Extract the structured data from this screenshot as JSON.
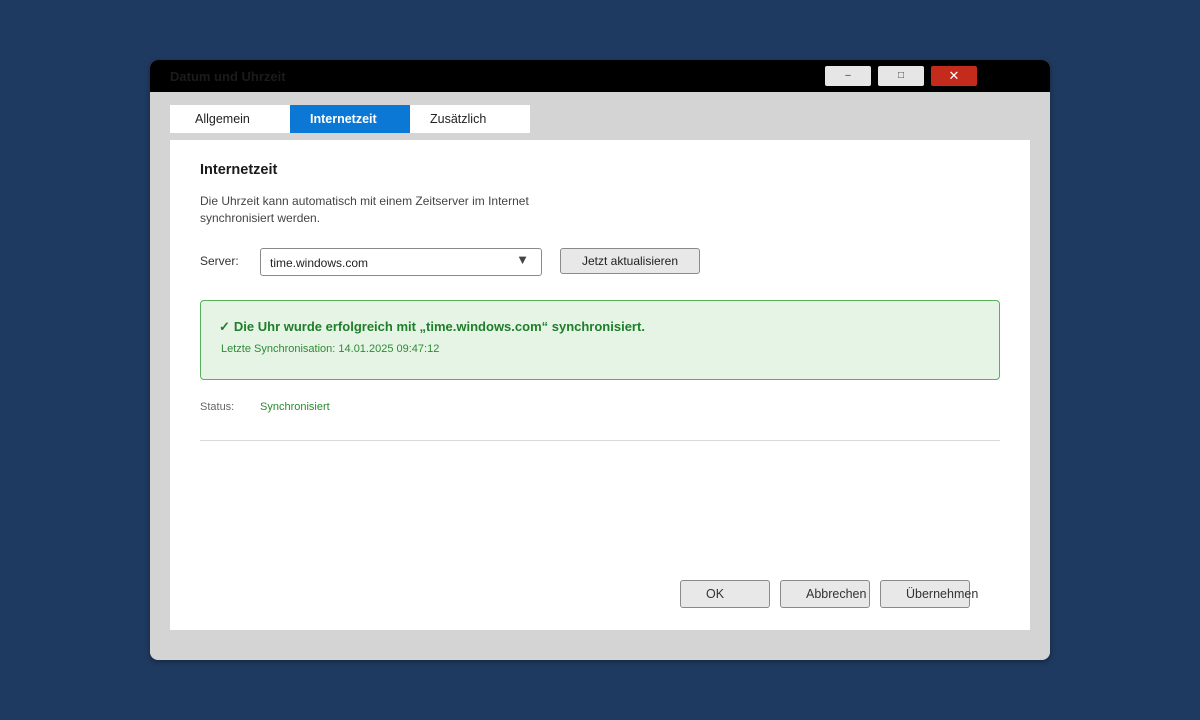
{
  "window": {
    "title": "Datum und Uhrzeit",
    "controls": {
      "minimize": "–",
      "maximize": "□",
      "close": "✕"
    }
  },
  "tabs": [
    {
      "label": "Allgemein",
      "active": false
    },
    {
      "label": "Internetzeit",
      "active": true
    },
    {
      "label": "Zusätzlich",
      "active": false
    }
  ],
  "panel": {
    "title": "Internetzeit",
    "description": "Die Uhrzeit kann automatisch mit einem Zeitserver im Internet synchronisiert werden.",
    "server": {
      "label": "Server:",
      "value": "time.windows.com",
      "arrow": "▼"
    },
    "update_button": "Jetzt aktualisieren",
    "success": {
      "check": "✓",
      "message": "Die Uhr wurde erfolgreich mit „time.windows.com“ synchronisiert.",
      "last_sync": "Letzte Synchronisation: 14.01.2025 09:47:12"
    },
    "status": {
      "label": "Status:",
      "value": "Synchronisiert"
    }
  },
  "buttons": {
    "ok": "OK",
    "cancel": "Abbrechen",
    "apply": "Übernehmen"
  },
  "colors": {
    "background": "#1f3a60",
    "accent": "#0a78d4",
    "success": "#1e7e2a",
    "success_bg": "#e6f4e6",
    "close_button": "#c42b1c"
  }
}
